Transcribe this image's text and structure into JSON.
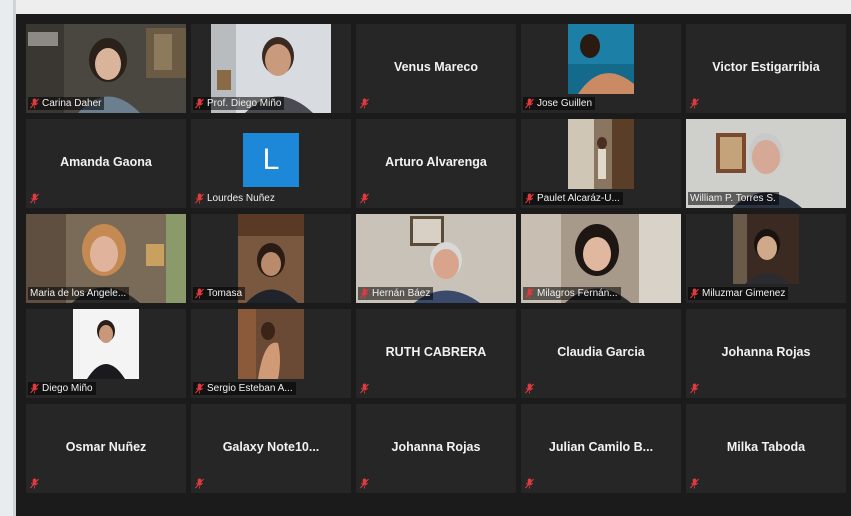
{
  "participants": [
    {
      "name": "Carina Daher",
      "video": true
    },
    {
      "name": "Prof. Diego Miño",
      "video": true
    },
    {
      "name": "Venus Mareco",
      "video": false
    },
    {
      "name": "Jose Guillen",
      "video": true
    },
    {
      "name": "Victor Estigarribia",
      "video": false
    },
    {
      "name": "Amanda Gaona",
      "video": false
    },
    {
      "name": "Lourdes Nuñez",
      "video": false,
      "avatar_letter": "L"
    },
    {
      "name": "Arturo Alvarenga",
      "video": false
    },
    {
      "name": "Paulet Alcaráz-U...",
      "video": true
    },
    {
      "name": "William P. Torres S.",
      "video": true
    },
    {
      "name": "Maria de los Angele...",
      "video": true,
      "active_speaker": true
    },
    {
      "name": "Tomasa",
      "video": true
    },
    {
      "name": "Hernán Báez",
      "video": true
    },
    {
      "name": "Milagros Fernán...",
      "video": true
    },
    {
      "name": "Miluzmar Gimenez",
      "video": true
    },
    {
      "name": "Diego Miño",
      "video": true
    },
    {
      "name": "Sergio Esteban A...",
      "video": true
    },
    {
      "name": "RUTH CABRERA",
      "video": false
    },
    {
      "name": "Claudia Garcia",
      "video": false
    },
    {
      "name": "Johanna Rojas",
      "video": false
    },
    {
      "name": "Osmar Nuñez",
      "video": false
    },
    {
      "name": "Galaxy Note10...",
      "video": false
    },
    {
      "name": "Johanna Rojas",
      "video": false
    },
    {
      "name": "Julian Camilo B...",
      "video": false
    },
    {
      "name": "Milka Taboda",
      "video": false
    }
  ],
  "colors": {
    "background": "#1b1b1b",
    "tile": "#262626",
    "active_speaker_border": "#cfe46b",
    "muted_icon": "#e0393e",
    "avatar_bg": "#1e88d8"
  },
  "icons": {
    "muted": "muted-mic-icon"
  }
}
